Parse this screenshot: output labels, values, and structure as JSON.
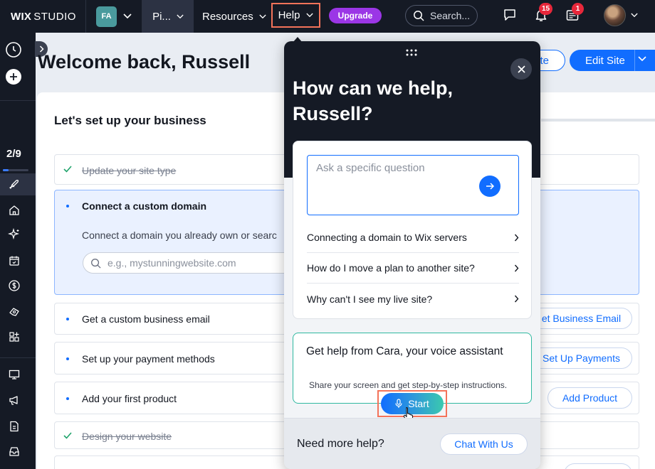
{
  "topbar": {
    "brand_bold": "WIX",
    "brand_thin": "STUDIO",
    "site_initials": "FA",
    "site_nav_label": "Pi...",
    "resources_label": "Resources",
    "help_label": "Help",
    "upgrade_label": "Upgrade",
    "search_label": "Search...",
    "notifications_count": "15",
    "updates_count": "1"
  },
  "sidebar": {
    "progress_text": "2/9",
    "progress_fraction": 0.22
  },
  "main": {
    "welcome": "Welcome back, Russell",
    "secondary_button": "te",
    "edit_site": "Edit Site",
    "setup_title": "Let's set up your business",
    "tasks": [
      {
        "label": "Update your site type",
        "done": true
      },
      {
        "label": "Connect a custom domain",
        "done": false,
        "description": "Connect a domain you already own or searc",
        "input_placeholder": "e.g., mystunningwebsite.com"
      },
      {
        "label": "Get a custom business email",
        "done": false,
        "action": "et Business Email"
      },
      {
        "label": "Set up your payment methods",
        "done": false,
        "action": "Set Up Payments"
      },
      {
        "label": "Add your first product",
        "done": false,
        "action": "Add Product"
      },
      {
        "label": "Design your website",
        "done": true
      }
    ]
  },
  "help_panel": {
    "title": "How can we help, Russell?",
    "ask_placeholder": "Ask a specific question",
    "faqs": [
      "Connecting a domain to Wix servers",
      "How do I move a plan to another site?",
      "Why can't I see my live site?"
    ],
    "cara_title": "Get help from Cara, your voice assistant",
    "cara_subtitle": "Share your screen and get step-by-step instructions.",
    "start_label": "Start",
    "footer_text": "Need more help?",
    "chat_label": "Chat With Us"
  },
  "colors": {
    "topbar_bg": "#151a25",
    "accent_blue": "#116dff",
    "upgrade_purple": "#9b36e6",
    "highlight_box": "#f4735a",
    "cara_border": "#2fb8a0"
  }
}
